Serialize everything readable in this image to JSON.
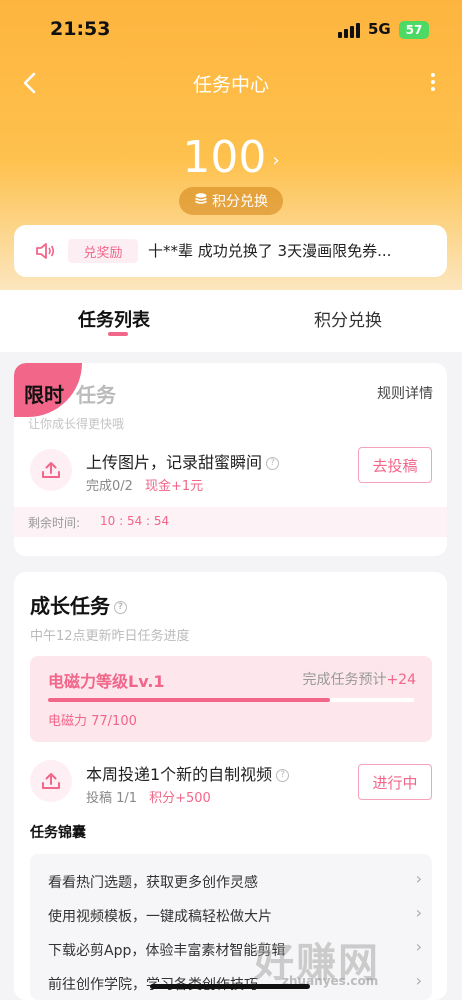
{
  "status_bar": {
    "time": "21:53",
    "network": "5G",
    "battery": "57"
  },
  "nav": {
    "title": "任务中心"
  },
  "points": {
    "value": "100",
    "chevron": "›",
    "exchange_label": "积分兑换"
  },
  "marquee": {
    "tag": "兑奖励",
    "text": "十**辈 成功兑换了 3天漫画限免券..."
  },
  "tabs": [
    {
      "label": "任务列表"
    },
    {
      "label": "积分兑换"
    }
  ],
  "limited_card": {
    "badge": "限时",
    "title": "任务",
    "subtitle": "让你成长得更快哦",
    "rules_label": "规则详情",
    "task": {
      "title": "上传图片，记录甜蜜瞬间",
      "progress": "完成0/2",
      "reward": "现金+1元",
      "button": "去投稿"
    },
    "timer_label": "剩余时间:",
    "timer_value": "10 : 54 : 54"
  },
  "growth_card": {
    "title": "成长任务",
    "subtitle": "中午12点更新昨日任务进度",
    "level": {
      "name": "电磁力等级Lv.1",
      "hint_prefix": "完成任务预计",
      "hint_value": "+24",
      "value_text": "电磁力 77/100",
      "progress": 0.77
    },
    "task": {
      "title": "本周投递1个新的自制视频",
      "progress": "投稿 1/1",
      "reward": "积分+500",
      "button": "进行中"
    },
    "kit_title": "任务锦囊",
    "kit_items": [
      {
        "label": "看看热门选题，获取更多创作灵感"
      },
      {
        "label": "使用视频模板，一键成稿轻松做大片"
      },
      {
        "label": "下载必剪App，体验丰富素材智能剪辑"
      },
      {
        "label": "前往创作学院，学习各类创作技巧"
      }
    ]
  },
  "watermark": {
    "main": "好赚网",
    "sub": "zhuanyes.com"
  },
  "colors": {
    "accent": "#f2668a",
    "header_top": "#fdb53f",
    "header_bottom": "#fbe6be"
  }
}
